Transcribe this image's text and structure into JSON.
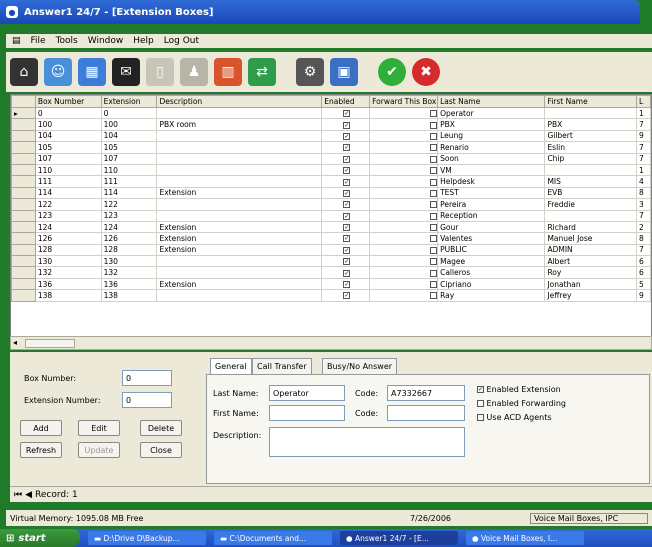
{
  "window": {
    "title": "Answer1 24/7 - [Extension Boxes]"
  },
  "menu": [
    "File",
    "Tools",
    "Window",
    "Help",
    "Log Out"
  ],
  "grid": {
    "columns": [
      "Box Number",
      "Extension",
      "Description",
      "Enabled",
      "Forward This Box",
      "Last Name",
      "First Name",
      "L"
    ],
    "rows": [
      {
        "box": "0",
        "ext": "0",
        "desc": "",
        "enabled": true,
        "fwd": false,
        "last": "Operator",
        "first": "",
        "l": "1"
      },
      {
        "box": "100",
        "ext": "100",
        "desc": "PBX room",
        "enabled": true,
        "fwd": false,
        "last": "PBX",
        "first": "PBX",
        "l": "7"
      },
      {
        "box": "104",
        "ext": "104",
        "desc": "",
        "enabled": true,
        "fwd": false,
        "last": "Leung",
        "first": "Gilbert",
        "l": "9"
      },
      {
        "box": "105",
        "ext": "105",
        "desc": "",
        "enabled": true,
        "fwd": false,
        "last": "Renario",
        "first": "Eslin",
        "l": "7"
      },
      {
        "box": "107",
        "ext": "107",
        "desc": "",
        "enabled": true,
        "fwd": false,
        "last": "Soon",
        "first": "Chip",
        "l": "7"
      },
      {
        "box": "110",
        "ext": "110",
        "desc": "",
        "enabled": true,
        "fwd": false,
        "last": "VM",
        "first": "",
        "l": "1"
      },
      {
        "box": "111",
        "ext": "111",
        "desc": "",
        "enabled": true,
        "fwd": false,
        "last": "Helpdesk",
        "first": "MIS",
        "l": "4"
      },
      {
        "box": "114",
        "ext": "114",
        "desc": "Extension",
        "enabled": true,
        "fwd": false,
        "last": "TEST",
        "first": "EVB",
        "l": "8"
      },
      {
        "box": "122",
        "ext": "122",
        "desc": "",
        "enabled": true,
        "fwd": false,
        "last": "Pereira",
        "first": "Freddie",
        "l": "3"
      },
      {
        "box": "123",
        "ext": "123",
        "desc": "",
        "enabled": true,
        "fwd": false,
        "last": "Reception",
        "first": "",
        "l": "7"
      },
      {
        "box": "124",
        "ext": "124",
        "desc": "Extension",
        "enabled": true,
        "fwd": false,
        "last": "Gour",
        "first": "Richard",
        "l": "2"
      },
      {
        "box": "126",
        "ext": "126",
        "desc": "Extension",
        "enabled": true,
        "fwd": false,
        "last": "Valentes",
        "first": "Manuel Jose",
        "l": "8"
      },
      {
        "box": "128",
        "ext": "128",
        "desc": "Extension",
        "enabled": true,
        "fwd": false,
        "last": "PUBLIC",
        "first": "ADMIN",
        "l": "7"
      },
      {
        "box": "130",
        "ext": "130",
        "desc": "",
        "enabled": true,
        "fwd": false,
        "last": "Magee",
        "first": "Albert",
        "l": "6"
      },
      {
        "box": "132",
        "ext": "132",
        "desc": "",
        "enabled": true,
        "fwd": false,
        "last": "Calleros",
        "first": "Roy",
        "l": "6"
      },
      {
        "box": "136",
        "ext": "136",
        "desc": "Extension",
        "enabled": true,
        "fwd": false,
        "last": "Cipriano",
        "first": "Jonathan",
        "l": "5"
      },
      {
        "box": "138",
        "ext": "138",
        "desc": "",
        "enabled": true,
        "fwd": false,
        "last": "Ray",
        "first": "Jeffrey",
        "l": "9"
      }
    ]
  },
  "left": {
    "box_label": "Box Number:",
    "box_value": "0",
    "ext_label": "Extension Number:",
    "ext_value": "0",
    "add": "Add",
    "edit": "Edit",
    "delete": "Delete",
    "refresh": "Refresh",
    "update": "Update",
    "close": "Close"
  },
  "right": {
    "tabs": [
      "General",
      "Call Transfer",
      "Busy/No Answer"
    ],
    "last_label": "Last Name:",
    "last_value": "Operator",
    "first_label": "First Name:",
    "first_value": "",
    "code_label": "Code:",
    "code_value": "A7332667",
    "code2_label": "Code:",
    "code2_value": "",
    "desc_label": "Description:",
    "desc_value": "",
    "opt_enabled": "Enabled Extension",
    "opt_forward": "Enabled Forwarding",
    "opt_acd": "Use ACD Agents"
  },
  "nav": {
    "record": "Record: 1"
  },
  "status": {
    "memory": "Virtual Memory: 1095.08 MB Free",
    "date": "7/26/2006",
    "panel": "Voice Mail Boxes, IPC"
  },
  "taskbar": {
    "start": "start",
    "tasks": [
      "D:\\Drive D\\Backup...",
      "C:\\Documents and...",
      "Answer1 24/7 - [E...",
      "Voice Mail Boxes, I..."
    ]
  }
}
